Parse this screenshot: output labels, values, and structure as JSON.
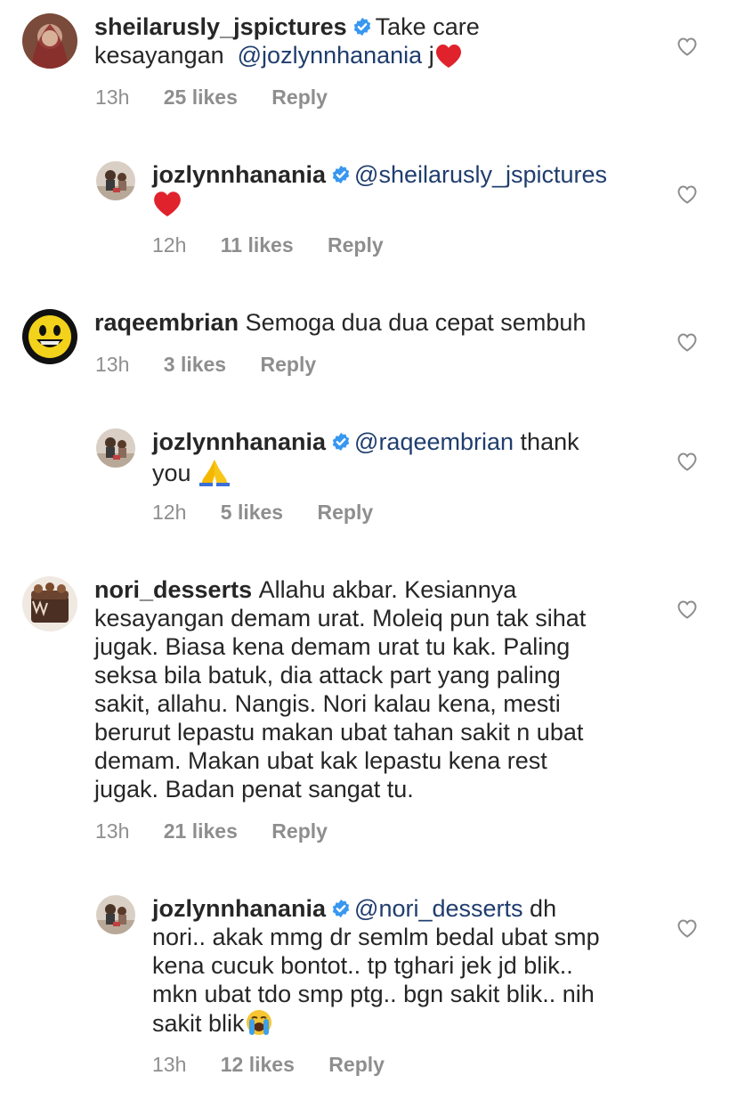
{
  "comments": [
    {
      "username": "sheilarusly_jspictures",
      "text_lines": [
        "Take care",
        "kesayangan"
      ],
      "mention": "@jozlynnhanania",
      "text_after": "j",
      "time": "13h",
      "likes": "25 likes",
      "reply_label": "Reply"
    },
    {
      "username": "jozlynnhanania",
      "mention": "@sheilarusly_jspictures",
      "time": "12h",
      "likes": "11 likes",
      "reply_label": "Reply"
    },
    {
      "username": "raqeembrian",
      "text": "Semoga dua dua cepat sembuh",
      "time": "13h",
      "likes": "3 likes",
      "reply_label": "Reply"
    },
    {
      "username": "jozlynnhanania",
      "mention": "@raqeembrian",
      "text": "thank",
      "text_line2": "you",
      "time": "12h",
      "likes": "5 likes",
      "reply_label": "Reply"
    },
    {
      "username": "nori_desserts",
      "text_line1": "Allahu akbar. Kesiannya",
      "text_lines": [
        "kesayangan demam urat. Moleiq pun tak sihat",
        "jugak. Biasa kena demam urat tu kak. Paling",
        "seksa bila batuk, dia attack part yang paling",
        "sakit, allahu. Nangis. Nori kalau kena, mesti",
        "berurut lepastu makan ubat tahan sakit n ubat",
        "demam. Makan ubat kak lepastu kena rest",
        "jugak. Badan penat sangat tu."
      ],
      "time": "13h",
      "likes": "21 likes",
      "reply_label": "Reply"
    },
    {
      "username": "jozlynnhanania",
      "mention": "@nori_desserts",
      "text_line1": "dh",
      "text_lines": [
        "nori.. akak mmg dr semlm bedal ubat smp",
        "kena cucuk bontot.. tp tghari jek jd blik..",
        "mkn ubat tdo smp ptg.. bgn sakit blik.. nih",
        "sakit blik"
      ],
      "time": "13h",
      "likes": "12 likes",
      "reply_label": "Reply"
    }
  ],
  "icons": {
    "verified": "verified-badge-icon",
    "like": "heart-outline-icon",
    "red_heart": "red-heart-emoji",
    "pray": "folded-hands-emoji",
    "crying": "loudly-crying-emoji"
  },
  "colors": {
    "text": "#262626",
    "meta": "#8e8e8e",
    "mention": "#1f3d6e",
    "verified": "#3897f0",
    "heart_emoji": "#e0222c"
  }
}
